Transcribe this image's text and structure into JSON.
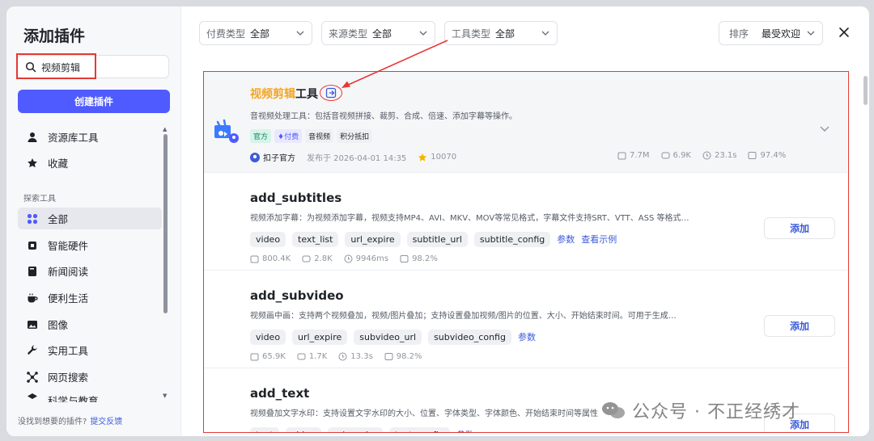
{
  "sidebar": {
    "title": "添加插件",
    "search_value": "视频剪辑",
    "create_label": "创建插件",
    "items_top": [
      {
        "label": "资源库工具",
        "icon": "person-icon"
      },
      {
        "label": "收藏",
        "icon": "star-icon"
      }
    ],
    "section_label": "探索工具",
    "items": [
      {
        "label": "全部",
        "icon": "grid-icon",
        "active": true
      },
      {
        "label": "智能硬件",
        "icon": "chip-icon"
      },
      {
        "label": "新闻阅读",
        "icon": "book-icon"
      },
      {
        "label": "便利生活",
        "icon": "coffee-icon"
      },
      {
        "label": "图像",
        "icon": "image-icon"
      },
      {
        "label": "实用工具",
        "icon": "wrench-icon"
      },
      {
        "label": "网页搜索",
        "icon": "network-icon"
      },
      {
        "label": "科学与教育",
        "icon": "school-icon"
      }
    ],
    "feedback_text": "没找到想要的插件?",
    "feedback_link": "提交反馈"
  },
  "filters": [
    {
      "label": "付费类型",
      "value": "全部"
    },
    {
      "label": "来源类型",
      "value": "全部"
    },
    {
      "label": "工具类型",
      "value": "全部"
    }
  ],
  "sort": {
    "label": "排序",
    "value": "最受欢迎"
  },
  "first_card": {
    "title_highlight": "视频剪辑",
    "title_rest": "工具",
    "description": "音视频处理工具：包括音视频拼接、裁剪、合成、倍速、添加字幕等操作。",
    "tags": [
      "官方",
      "付费",
      "音视频",
      "积分抵扣"
    ],
    "author": "扣子官方",
    "published": "发布于 2026-04-01 14:35",
    "stars": "10070",
    "stats": [
      "7.7M",
      "6.9K",
      "23.1s",
      "97.4%"
    ]
  },
  "tools": [
    {
      "name": "add_subtitles",
      "description": "视频添加字幕：为视频添加字幕，视频支持MP4、AVI、MKV、MOV等常见格式，字幕文件支持SRT、VTT、ASS 等格式…",
      "params": [
        "video",
        "text_list",
        "url_expire",
        "subtitle_url",
        "subtitle_config"
      ],
      "links": [
        "参数",
        "查看示例"
      ],
      "stats": [
        "800.4K",
        "2.8K",
        "9946ms",
        "98.2%"
      ],
      "add_label": "添加"
    },
    {
      "name": "add_subvideo",
      "description": "视频画中画：支持两个视频叠加，视频/图片叠加；支持设置叠加视频/图片的位置、大小、开始结束时间。可用于生成…",
      "params": [
        "video",
        "url_expire",
        "subvideo_url",
        "subvideo_config"
      ],
      "links": [
        "参数"
      ],
      "stats": [
        "65.9K",
        "1.7K",
        "13.3s",
        "98.2%"
      ],
      "add_label": "添加"
    },
    {
      "name": "add_text",
      "description": "视频叠加文字水印：支持设置文字水印的大小、位置、字体类型、字体颜色、开始结束时间等属性",
      "params": [
        "text",
        "video",
        "url_expire",
        "text_config"
      ],
      "links": [
        "参数"
      ],
      "stats": [],
      "add_label": "添加"
    }
  ],
  "watermark": "公众号 · 不正经绣才",
  "colors": {
    "accent": "#4f5bff",
    "highlight": "#f5a623",
    "annotation": "#e53935",
    "link": "#3b5bdb"
  }
}
